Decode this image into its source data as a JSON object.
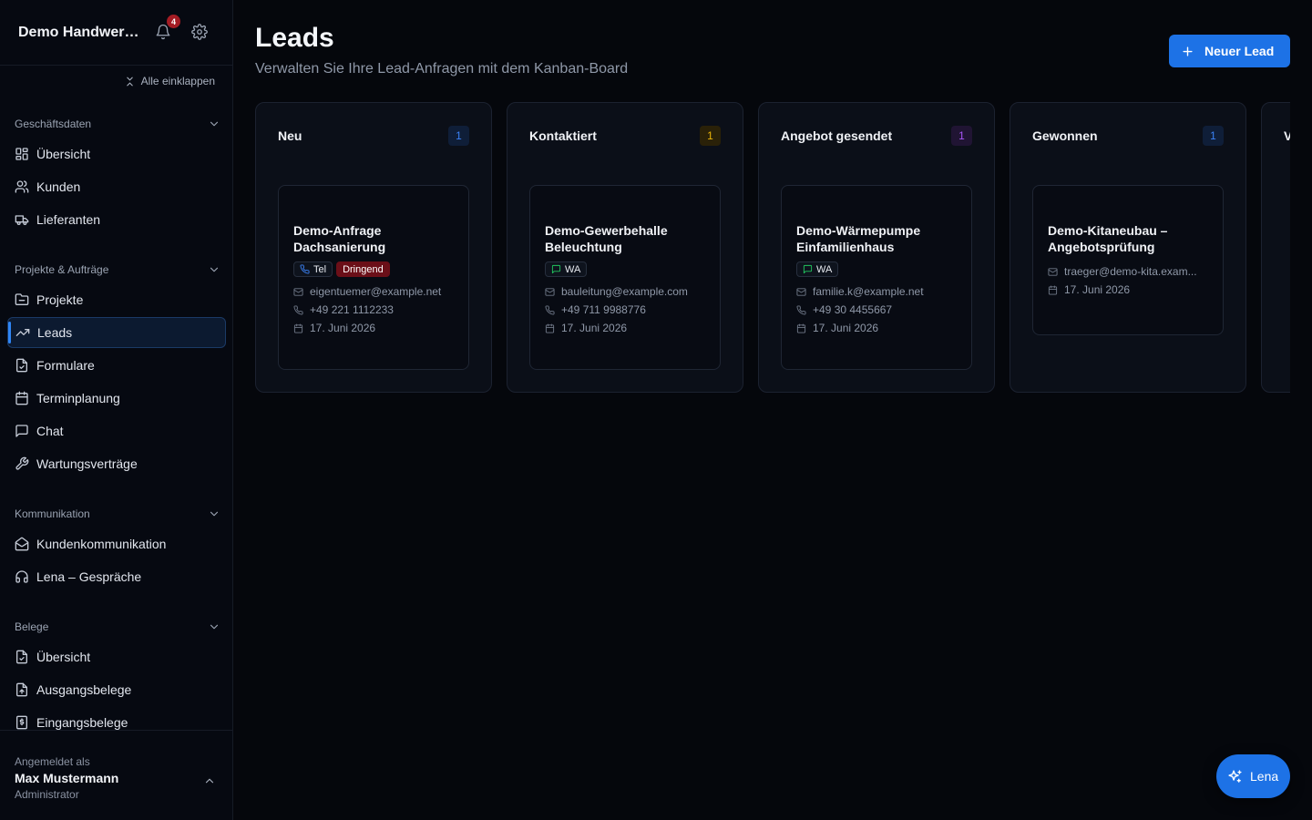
{
  "sidebar": {
    "brand": "Demo Handwerk GmbH",
    "notification_count": "4",
    "collapse_all": "Alle einklappen",
    "sections": [
      {
        "title": "Geschäftsdaten",
        "items": [
          {
            "label": "Übersicht",
            "icon": "dashboard-icon"
          },
          {
            "label": "Kunden",
            "icon": "users-icon"
          },
          {
            "label": "Lieferanten",
            "icon": "truck-icon"
          }
        ]
      },
      {
        "title": "Projekte & Aufträge",
        "items": [
          {
            "label": "Projekte",
            "icon": "folder-icon"
          },
          {
            "label": "Leads",
            "icon": "trending-up-icon",
            "active": true
          },
          {
            "label": "Formulare",
            "icon": "form-icon"
          },
          {
            "label": "Terminplanung",
            "icon": "calendar-icon"
          },
          {
            "label": "Chat",
            "icon": "chat-icon"
          },
          {
            "label": "Wartungsverträge",
            "icon": "wrench-icon"
          }
        ]
      },
      {
        "title": "Kommunikation",
        "items": [
          {
            "label": "Kundenkommunikation",
            "icon": "mail-open-icon"
          },
          {
            "label": "Lena – Gespräche",
            "icon": "headphones-icon"
          }
        ]
      },
      {
        "title": "Belege",
        "items": [
          {
            "label": "Übersicht",
            "icon": "document-icon"
          },
          {
            "label": "Ausgangsbelege",
            "icon": "document-out-icon"
          },
          {
            "label": "Eingangsbelege",
            "icon": "receipt-icon"
          }
        ]
      }
    ],
    "footer": {
      "label": "Angemeldet als",
      "name": "Max Mustermann",
      "role": "Administrator"
    }
  },
  "main": {
    "title": "Leads",
    "subtitle": "Verwalten Sie Ihre Lead-Anfragen mit dem Kanban-Board",
    "new_button": "Neuer Lead",
    "columns": [
      {
        "title": "Neu",
        "count": "1",
        "count_color": "#3b82f6",
        "count_bg": "#0f1e38",
        "card": {
          "title": "Demo-Anfrage Dachsanierung",
          "channel": "Tel",
          "channel_icon": "phone-icon",
          "channel_color": "#3b82f6",
          "urgent": "Dringend",
          "email": "eigentuemer@example.net",
          "phone": "+49 221 1112233",
          "date": "17. Juni 2026"
        }
      },
      {
        "title": "Kontaktiert",
        "count": "1",
        "count_color": "#eab308",
        "count_bg": "#2a2108",
        "card": {
          "title": "Demo-Gewerbehalle Beleuchtung",
          "channel": "WA",
          "channel_icon": "message-icon",
          "channel_color": "#22c55e",
          "email": "bauleitung@example.com",
          "phone": "+49 711 9988776",
          "date": "17. Juni 2026"
        }
      },
      {
        "title": "Angebot gesendet",
        "count": "1",
        "count_color": "#a855f7",
        "count_bg": "#201433",
        "card": {
          "title": "Demo-Wärmepumpe Einfamilienhaus",
          "channel": "WA",
          "channel_icon": "message-icon",
          "channel_color": "#22c55e",
          "email": "familie.k@example.net",
          "phone": "+49 30 4455667",
          "date": "17. Juni 2026"
        }
      },
      {
        "title": "Gewonnen",
        "count": "1",
        "count_color": "#3b82f6",
        "count_bg": "#0f1e38",
        "card": {
          "title": "Demo-Kitaneubau – Angebotsprüfung",
          "email": "traeger@demo-kita.exam...",
          "date": "17. Juni 2026"
        }
      },
      {
        "title": "V"
      }
    ]
  },
  "assistant_button": "Lena"
}
